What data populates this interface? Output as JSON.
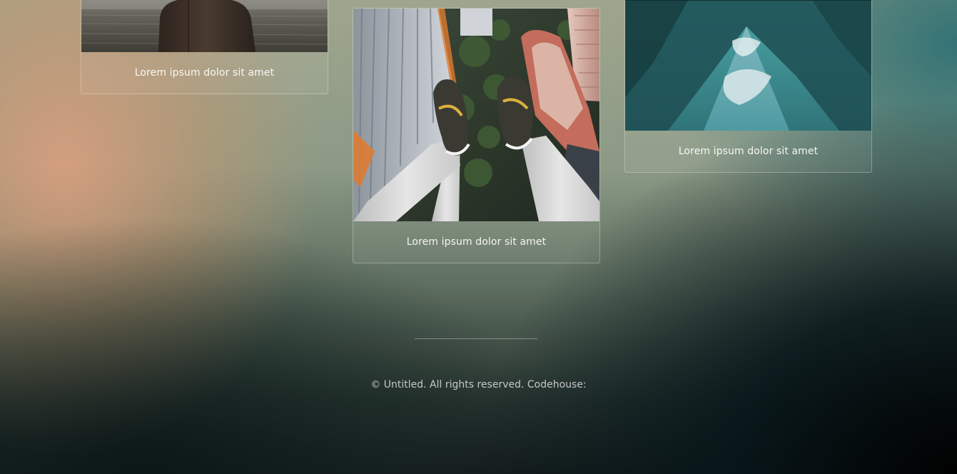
{
  "gallery": {
    "cards": [
      {
        "caption": "Lorem ipsum dolor sit amet",
        "image": "person-by-waterfront-photo"
      },
      {
        "caption": "Lorem ipsum dolor sit amet",
        "image": "feet-over-city-photo"
      },
      {
        "caption": "Lorem ipsum dolor sit amet",
        "image": "mountain-lake-reflection-photo"
      }
    ]
  },
  "footer": {
    "copyright": "© Untitled. All rights reserved. Codehouse:"
  }
}
